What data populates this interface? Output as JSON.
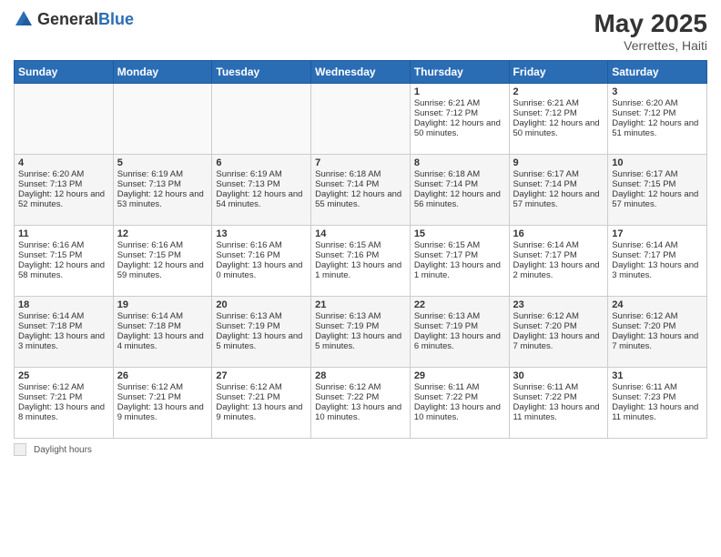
{
  "header": {
    "logo_general": "General",
    "logo_blue": "Blue",
    "month": "May 2025",
    "location": "Verrettes, Haiti"
  },
  "weekdays": [
    "Sunday",
    "Monday",
    "Tuesday",
    "Wednesday",
    "Thursday",
    "Friday",
    "Saturday"
  ],
  "weeks": [
    [
      {
        "day": "",
        "sunrise": "",
        "sunset": "",
        "daylight": ""
      },
      {
        "day": "",
        "sunrise": "",
        "sunset": "",
        "daylight": ""
      },
      {
        "day": "",
        "sunrise": "",
        "sunset": "",
        "daylight": ""
      },
      {
        "day": "",
        "sunrise": "",
        "sunset": "",
        "daylight": ""
      },
      {
        "day": "1",
        "sunrise": "Sunrise: 6:21 AM",
        "sunset": "Sunset: 7:12 PM",
        "daylight": "Daylight: 12 hours and 50 minutes."
      },
      {
        "day": "2",
        "sunrise": "Sunrise: 6:21 AM",
        "sunset": "Sunset: 7:12 PM",
        "daylight": "Daylight: 12 hours and 50 minutes."
      },
      {
        "day": "3",
        "sunrise": "Sunrise: 6:20 AM",
        "sunset": "Sunset: 7:12 PM",
        "daylight": "Daylight: 12 hours and 51 minutes."
      }
    ],
    [
      {
        "day": "4",
        "sunrise": "Sunrise: 6:20 AM",
        "sunset": "Sunset: 7:13 PM",
        "daylight": "Daylight: 12 hours and 52 minutes."
      },
      {
        "day": "5",
        "sunrise": "Sunrise: 6:19 AM",
        "sunset": "Sunset: 7:13 PM",
        "daylight": "Daylight: 12 hours and 53 minutes."
      },
      {
        "day": "6",
        "sunrise": "Sunrise: 6:19 AM",
        "sunset": "Sunset: 7:13 PM",
        "daylight": "Daylight: 12 hours and 54 minutes."
      },
      {
        "day": "7",
        "sunrise": "Sunrise: 6:18 AM",
        "sunset": "Sunset: 7:14 PM",
        "daylight": "Daylight: 12 hours and 55 minutes."
      },
      {
        "day": "8",
        "sunrise": "Sunrise: 6:18 AM",
        "sunset": "Sunset: 7:14 PM",
        "daylight": "Daylight: 12 hours and 56 minutes."
      },
      {
        "day": "9",
        "sunrise": "Sunrise: 6:17 AM",
        "sunset": "Sunset: 7:14 PM",
        "daylight": "Daylight: 12 hours and 57 minutes."
      },
      {
        "day": "10",
        "sunrise": "Sunrise: 6:17 AM",
        "sunset": "Sunset: 7:15 PM",
        "daylight": "Daylight: 12 hours and 57 minutes."
      }
    ],
    [
      {
        "day": "11",
        "sunrise": "Sunrise: 6:16 AM",
        "sunset": "Sunset: 7:15 PM",
        "daylight": "Daylight: 12 hours and 58 minutes."
      },
      {
        "day": "12",
        "sunrise": "Sunrise: 6:16 AM",
        "sunset": "Sunset: 7:15 PM",
        "daylight": "Daylight: 12 hours and 59 minutes."
      },
      {
        "day": "13",
        "sunrise": "Sunrise: 6:16 AM",
        "sunset": "Sunset: 7:16 PM",
        "daylight": "Daylight: 13 hours and 0 minutes."
      },
      {
        "day": "14",
        "sunrise": "Sunrise: 6:15 AM",
        "sunset": "Sunset: 7:16 PM",
        "daylight": "Daylight: 13 hours and 1 minute."
      },
      {
        "day": "15",
        "sunrise": "Sunrise: 6:15 AM",
        "sunset": "Sunset: 7:17 PM",
        "daylight": "Daylight: 13 hours and 1 minute."
      },
      {
        "day": "16",
        "sunrise": "Sunrise: 6:14 AM",
        "sunset": "Sunset: 7:17 PM",
        "daylight": "Daylight: 13 hours and 2 minutes."
      },
      {
        "day": "17",
        "sunrise": "Sunrise: 6:14 AM",
        "sunset": "Sunset: 7:17 PM",
        "daylight": "Daylight: 13 hours and 3 minutes."
      }
    ],
    [
      {
        "day": "18",
        "sunrise": "Sunrise: 6:14 AM",
        "sunset": "Sunset: 7:18 PM",
        "daylight": "Daylight: 13 hours and 3 minutes."
      },
      {
        "day": "19",
        "sunrise": "Sunrise: 6:14 AM",
        "sunset": "Sunset: 7:18 PM",
        "daylight": "Daylight: 13 hours and 4 minutes."
      },
      {
        "day": "20",
        "sunrise": "Sunrise: 6:13 AM",
        "sunset": "Sunset: 7:19 PM",
        "daylight": "Daylight: 13 hours and 5 minutes."
      },
      {
        "day": "21",
        "sunrise": "Sunrise: 6:13 AM",
        "sunset": "Sunset: 7:19 PM",
        "daylight": "Daylight: 13 hours and 5 minutes."
      },
      {
        "day": "22",
        "sunrise": "Sunrise: 6:13 AM",
        "sunset": "Sunset: 7:19 PM",
        "daylight": "Daylight: 13 hours and 6 minutes."
      },
      {
        "day": "23",
        "sunrise": "Sunrise: 6:12 AM",
        "sunset": "Sunset: 7:20 PM",
        "daylight": "Daylight: 13 hours and 7 minutes."
      },
      {
        "day": "24",
        "sunrise": "Sunrise: 6:12 AM",
        "sunset": "Sunset: 7:20 PM",
        "daylight": "Daylight: 13 hours and 7 minutes."
      }
    ],
    [
      {
        "day": "25",
        "sunrise": "Sunrise: 6:12 AM",
        "sunset": "Sunset: 7:21 PM",
        "daylight": "Daylight: 13 hours and 8 minutes."
      },
      {
        "day": "26",
        "sunrise": "Sunrise: 6:12 AM",
        "sunset": "Sunset: 7:21 PM",
        "daylight": "Daylight: 13 hours and 9 minutes."
      },
      {
        "day": "27",
        "sunrise": "Sunrise: 6:12 AM",
        "sunset": "Sunset: 7:21 PM",
        "daylight": "Daylight: 13 hours and 9 minutes."
      },
      {
        "day": "28",
        "sunrise": "Sunrise: 6:12 AM",
        "sunset": "Sunset: 7:22 PM",
        "daylight": "Daylight: 13 hours and 10 minutes."
      },
      {
        "day": "29",
        "sunrise": "Sunrise: 6:11 AM",
        "sunset": "Sunset: 7:22 PM",
        "daylight": "Daylight: 13 hours and 10 minutes."
      },
      {
        "day": "30",
        "sunrise": "Sunrise: 6:11 AM",
        "sunset": "Sunset: 7:22 PM",
        "daylight": "Daylight: 13 hours and 11 minutes."
      },
      {
        "day": "31",
        "sunrise": "Sunrise: 6:11 AM",
        "sunset": "Sunset: 7:23 PM",
        "daylight": "Daylight: 13 hours and 11 minutes."
      }
    ]
  ],
  "footer": {
    "label": "Daylight hours"
  }
}
